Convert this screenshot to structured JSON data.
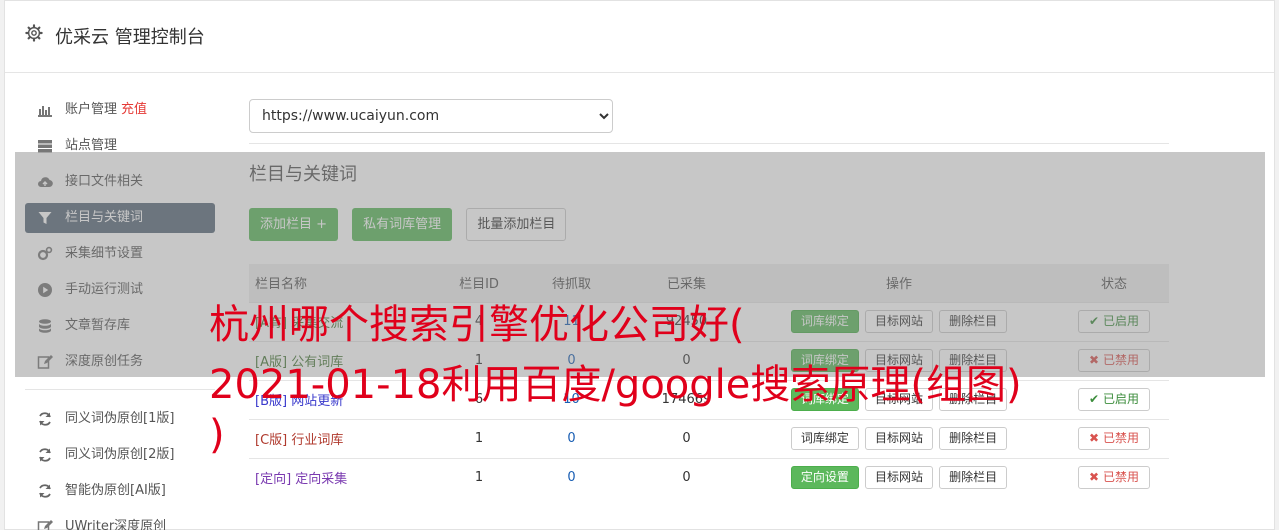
{
  "header": {
    "title": "优采云 管理控制台",
    "icon": "gear-icon"
  },
  "sidebar": {
    "items": [
      {
        "label": "账户管理",
        "extra": "充值",
        "icon": "bar-chart-icon"
      },
      {
        "label": "站点管理",
        "icon": "server-icon"
      },
      {
        "label": "接口文件相关",
        "icon": "cloud-upload-icon"
      },
      {
        "label": "栏目与关键词",
        "icon": "filter-icon",
        "active": true
      },
      {
        "label": "采集细节设置",
        "icon": "cogs-icon"
      },
      {
        "label": "手动运行测试",
        "icon": "play-circle-icon"
      },
      {
        "label": "文章暂存库",
        "icon": "database-icon"
      },
      {
        "label": "深度原创任务",
        "icon": "edit-icon"
      }
    ],
    "items2": [
      {
        "label": "同义词伪原创[1版]",
        "icon": "refresh-icon"
      },
      {
        "label": "同义词伪原创[2版]",
        "icon": "refresh-icon"
      },
      {
        "label": "智能伪原创[AI版]",
        "icon": "refresh-icon"
      },
      {
        "label": "UWriter深度原创",
        "icon": "edit-icon"
      }
    ]
  },
  "main": {
    "site_select": "https://www.ucaiyun.com",
    "section_title": "栏目与关键词",
    "buttons": {
      "add": "添加栏目 +",
      "private_lib": "私有词库管理",
      "batch_add": "批量添加栏目"
    },
    "columns": [
      "栏目名称",
      "栏目ID",
      "待抓取",
      "已采集",
      "操作",
      "状态"
    ],
    "rows": [
      {
        "tag": "[A有]",
        "name": "采集交流",
        "id": "4",
        "pending": "11",
        "collected": "92450",
        "op1": "词库绑定",
        "op2": "目标网站",
        "op3": "删除栏目",
        "status": "已启用",
        "state": "on",
        "cls": "tag-a"
      },
      {
        "tag": "[A版]",
        "name": "公有词库",
        "id": "1",
        "pending": "0",
        "collected": "0",
        "op1": "词库绑定",
        "op2": "目标网站",
        "op3": "删除栏目",
        "status": "已禁用",
        "state": "off",
        "cls": "tag-a"
      },
      {
        "tag": "[B版]",
        "name": "网站更新",
        "id": "6",
        "pending": "10",
        "collected": "174669",
        "op1": "词库绑定",
        "op2": "目标网站",
        "op3": "删除栏目",
        "status": "已启用",
        "state": "on",
        "cls": "tag-b"
      },
      {
        "tag": "[C版]",
        "name": "行业词库",
        "id": "1",
        "pending": "0",
        "collected": "0",
        "op1": "词库绑定",
        "op2": "目标网站",
        "op3": "删除栏目",
        "status": "已禁用",
        "state": "off",
        "cls": "tag-c"
      },
      {
        "tag": "[定向]",
        "name": "定向采集",
        "id": "1",
        "pending": "0",
        "collected": "0",
        "op1": "定向设置",
        "op2": "目标网站",
        "op3": "删除栏目",
        "status": "已禁用",
        "state": "off",
        "cls": "tag-d"
      }
    ]
  },
  "watermark": {
    "line1": "杭州哪个搜索引擎优化公司好(",
    "line2": "2021-01-18利用百度/google搜索原理(组图)",
    "line3": ")"
  },
  "colors": {
    "accent_green": "#5cb85c",
    "active_sidebar": "#5a6a7a",
    "watermark_red": "#e0001b",
    "recharge_red": "#e53935"
  }
}
